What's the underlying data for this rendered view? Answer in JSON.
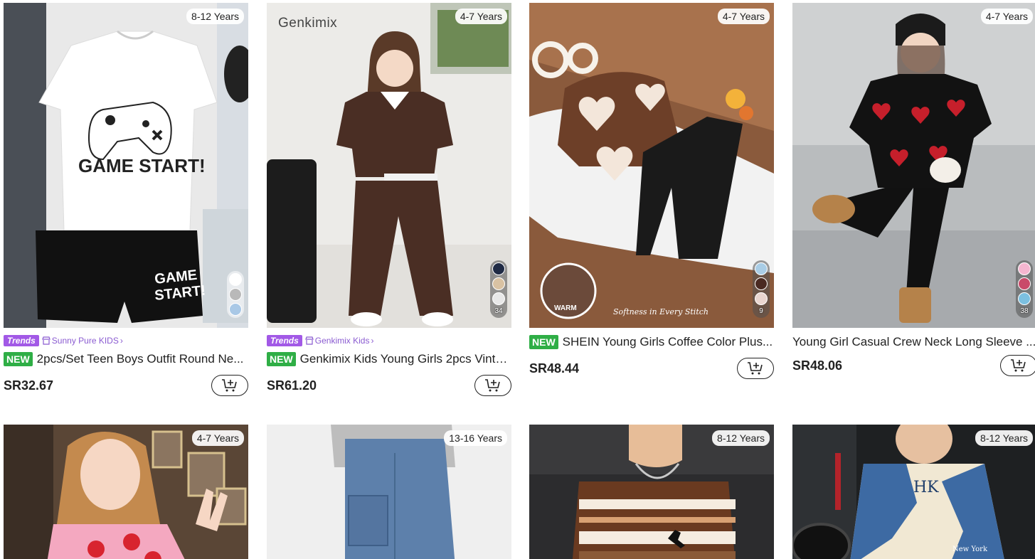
{
  "products": [
    {
      "age": "8-12 Years",
      "trends_label": "Trends",
      "store": "Sunny Pure KIDS",
      "is_new": true,
      "new_label": "NEW",
      "title": "2pcs/Set Teen Boys Outfit Round Ne...",
      "price": "SR32.67",
      "print_text": "GAME START!",
      "swatches": [
        "#ffffff",
        "#b9b9b9",
        "#a9c8e6"
      ],
      "swatch_count": ""
    },
    {
      "age": "4-7 Years",
      "trends_label": "Trends",
      "store": "Genkimix Kids",
      "watermark": "Genkimix",
      "is_new": true,
      "new_label": "NEW",
      "title": "Genkimix Kids Young Girls 2pcs Vinta...",
      "price": "SR61.20",
      "swatches": [
        "#1f2a44",
        "#d9c2a3",
        "#e8e8e8"
      ],
      "swatch_count": "34"
    },
    {
      "age": "4-7 Years",
      "is_new": true,
      "new_label": "NEW",
      "title": "SHEIN Young Girls Coffee Color Plus...",
      "price": "SR48.44",
      "inset_label": "WARM",
      "caption": "Softness in Every Stitch",
      "swatches": [
        "#a9cde6",
        "#4a2a22",
        "#e9d6d0"
      ],
      "swatch_count": "9"
    },
    {
      "age": "4-7 Years",
      "is_new": false,
      "title": "Young Girl Casual Crew Neck Long Sleeve ...",
      "price": "SR48.06",
      "swatches": [
        "#f5b6d0",
        "#c94a6a",
        "#7cc0e0"
      ],
      "swatch_count": "38"
    },
    {
      "age": "4-7 Years"
    },
    {
      "age": "13-16 Years"
    },
    {
      "age": "8-12 Years"
    },
    {
      "age": "8-12 Years",
      "print_text": "HK",
      "print_text_2": "New York"
    }
  ],
  "colors": {
    "trends": "#a259e6",
    "new": "#2fae46",
    "store": "#8a5bd1"
  }
}
